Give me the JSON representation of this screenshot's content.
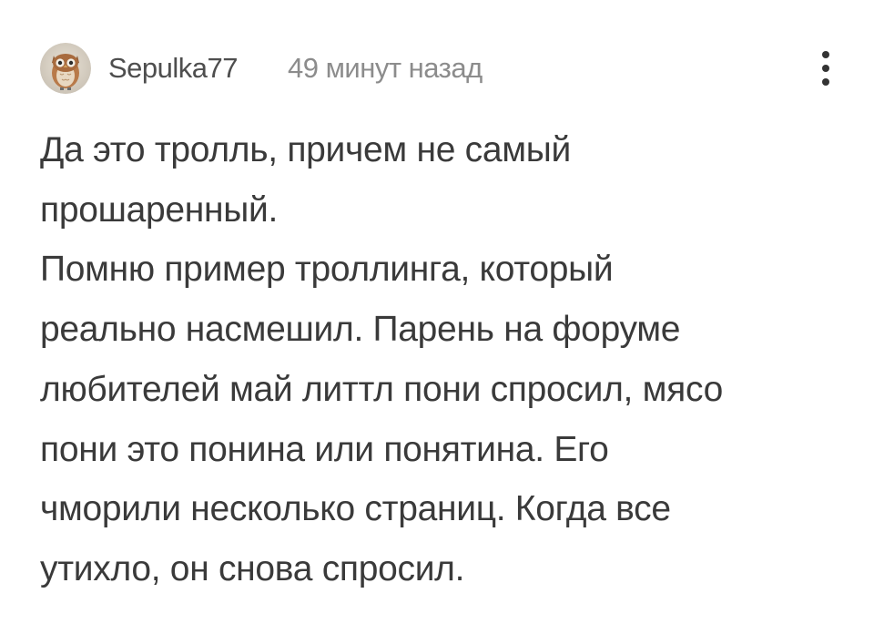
{
  "comment": {
    "author": {
      "username": "Sepulka77",
      "avatar_icon": "owl-avatar-icon"
    },
    "timestamp": "49 минут назад",
    "more_icon": "more-vertical-icon",
    "lines": [
      "Да это тролль, причем не самый",
      "прошаренный.",
      "Помню пример троллинга, который",
      "реально насмешил. Парень на форуме",
      "любителей май литтл пони спросил, мясо",
      "пони это понина или понятина. Его",
      "чморили несколько страниц. Когда все",
      "утихло, он снова спросил."
    ]
  },
  "colors": {
    "background": "#ffffff",
    "username": "#4e4e4e",
    "timestamp": "#8c8c8c",
    "text": "#3a3a3a",
    "menu_dots": "#333333"
  }
}
